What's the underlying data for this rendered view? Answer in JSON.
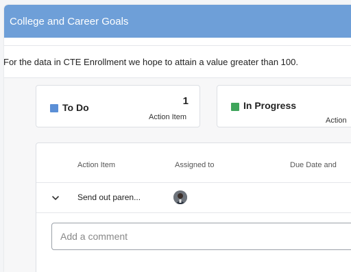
{
  "header": {
    "title": "College and Career Goals"
  },
  "goal": {
    "description": "For the data in CTE Enrollment we hope to attain a value greater than 100."
  },
  "status_cards": {
    "todo": {
      "label": "To Do",
      "count": "1",
      "sub": "Action Item",
      "color": "#5b8fd6"
    },
    "in_progress": {
      "label": "In Progress",
      "sub": "Action",
      "color": "#3fa55b"
    }
  },
  "table": {
    "columns": [
      "Action Item",
      "Assigned to",
      "Due Date and"
    ],
    "rows": [
      {
        "action_item": "Send out paren..."
      }
    ]
  },
  "comment": {
    "placeholder": "Add a comment"
  }
}
